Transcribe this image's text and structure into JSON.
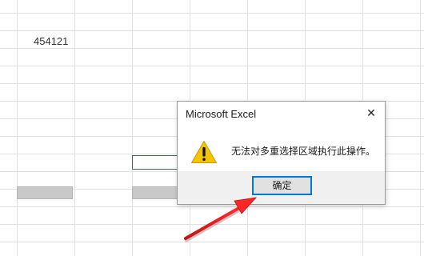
{
  "sheet": {
    "cells": {
      "c1_value": "454121"
    }
  },
  "dialog": {
    "title": "Microsoft Excel",
    "close_glyph": "✕",
    "message": "无法对多重选择区域执行此操作。",
    "ok_label": "确定",
    "icon": "warning-icon"
  },
  "annotation": {
    "arrow_color": "#e02020",
    "points_to": "ok-button"
  },
  "colors": {
    "gridline": "#e1e1e1",
    "selected_cell_border": "#3d6e47",
    "gray_cells": "#c9c9c9",
    "ok_button_focus": "#0078d7",
    "warning_yellow": "#f5c400"
  }
}
